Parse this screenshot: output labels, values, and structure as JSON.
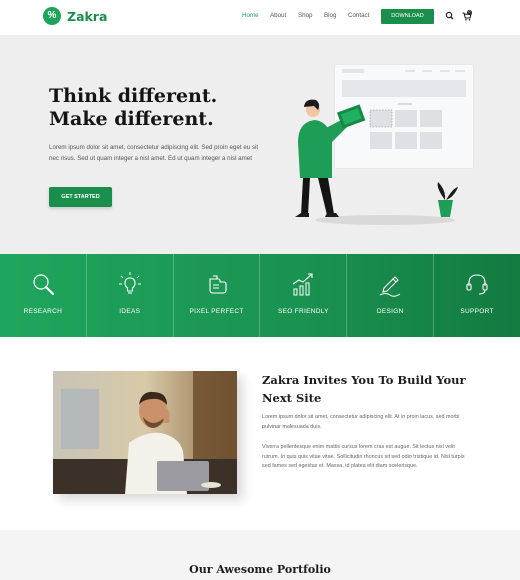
{
  "brand": {
    "name": "Zakra",
    "mark": "%",
    "color": "#1ea35a"
  },
  "nav": {
    "items": [
      "Home",
      "About",
      "Shop",
      "Blog",
      "Contact"
    ],
    "download": "DOWNLOAD",
    "cart_count": "0"
  },
  "hero": {
    "title_line1": "Think different.",
    "title_line2": "Make different.",
    "text": "Lorem ipsum dolor sit amet, consectetur adipiscing elit. Sed proin eget eu sit nec risus. Sed ut quam integer a nisl amet.  Ed ut quam integer a nisl amet",
    "cta": "GET STARTED"
  },
  "features": [
    {
      "label": "RESEARCH",
      "icon": "magnifier-icon"
    },
    {
      "label": "IDEAS",
      "icon": "lightbulb-icon"
    },
    {
      "label": "PIXEL PERFECT",
      "icon": "hand-icon"
    },
    {
      "label": "SEO FRIENDLY",
      "icon": "growth-chart-icon"
    },
    {
      "label": "DESIGN",
      "icon": "pen-icon"
    },
    {
      "label": "SUPPORT",
      "icon": "headset-icon"
    }
  ],
  "about": {
    "title": "Zakra Invites You To Build Your Next Site",
    "p1": "Lorem ipsum dolor sit amet, consectetur adipiscing elit. At in proin lacus, sed morbi pulvinar malesuada duis.",
    "p2": "Viverra pellentesque enim mattis cursus lorem cras est augue. Sit lectus nisl velit rutrum. In quis quis vitae vitae. Sollicitudin rhoncus sit sed odio tristique id. Nisl turpis sed fames sed egestas et. Massa, id platea elit diam scelerisque."
  },
  "portfolio": {
    "title": "Our Awesome Portfolio"
  },
  "colors": {
    "accent": "#1a8f4c",
    "hero_bg": "#eeeeee"
  }
}
